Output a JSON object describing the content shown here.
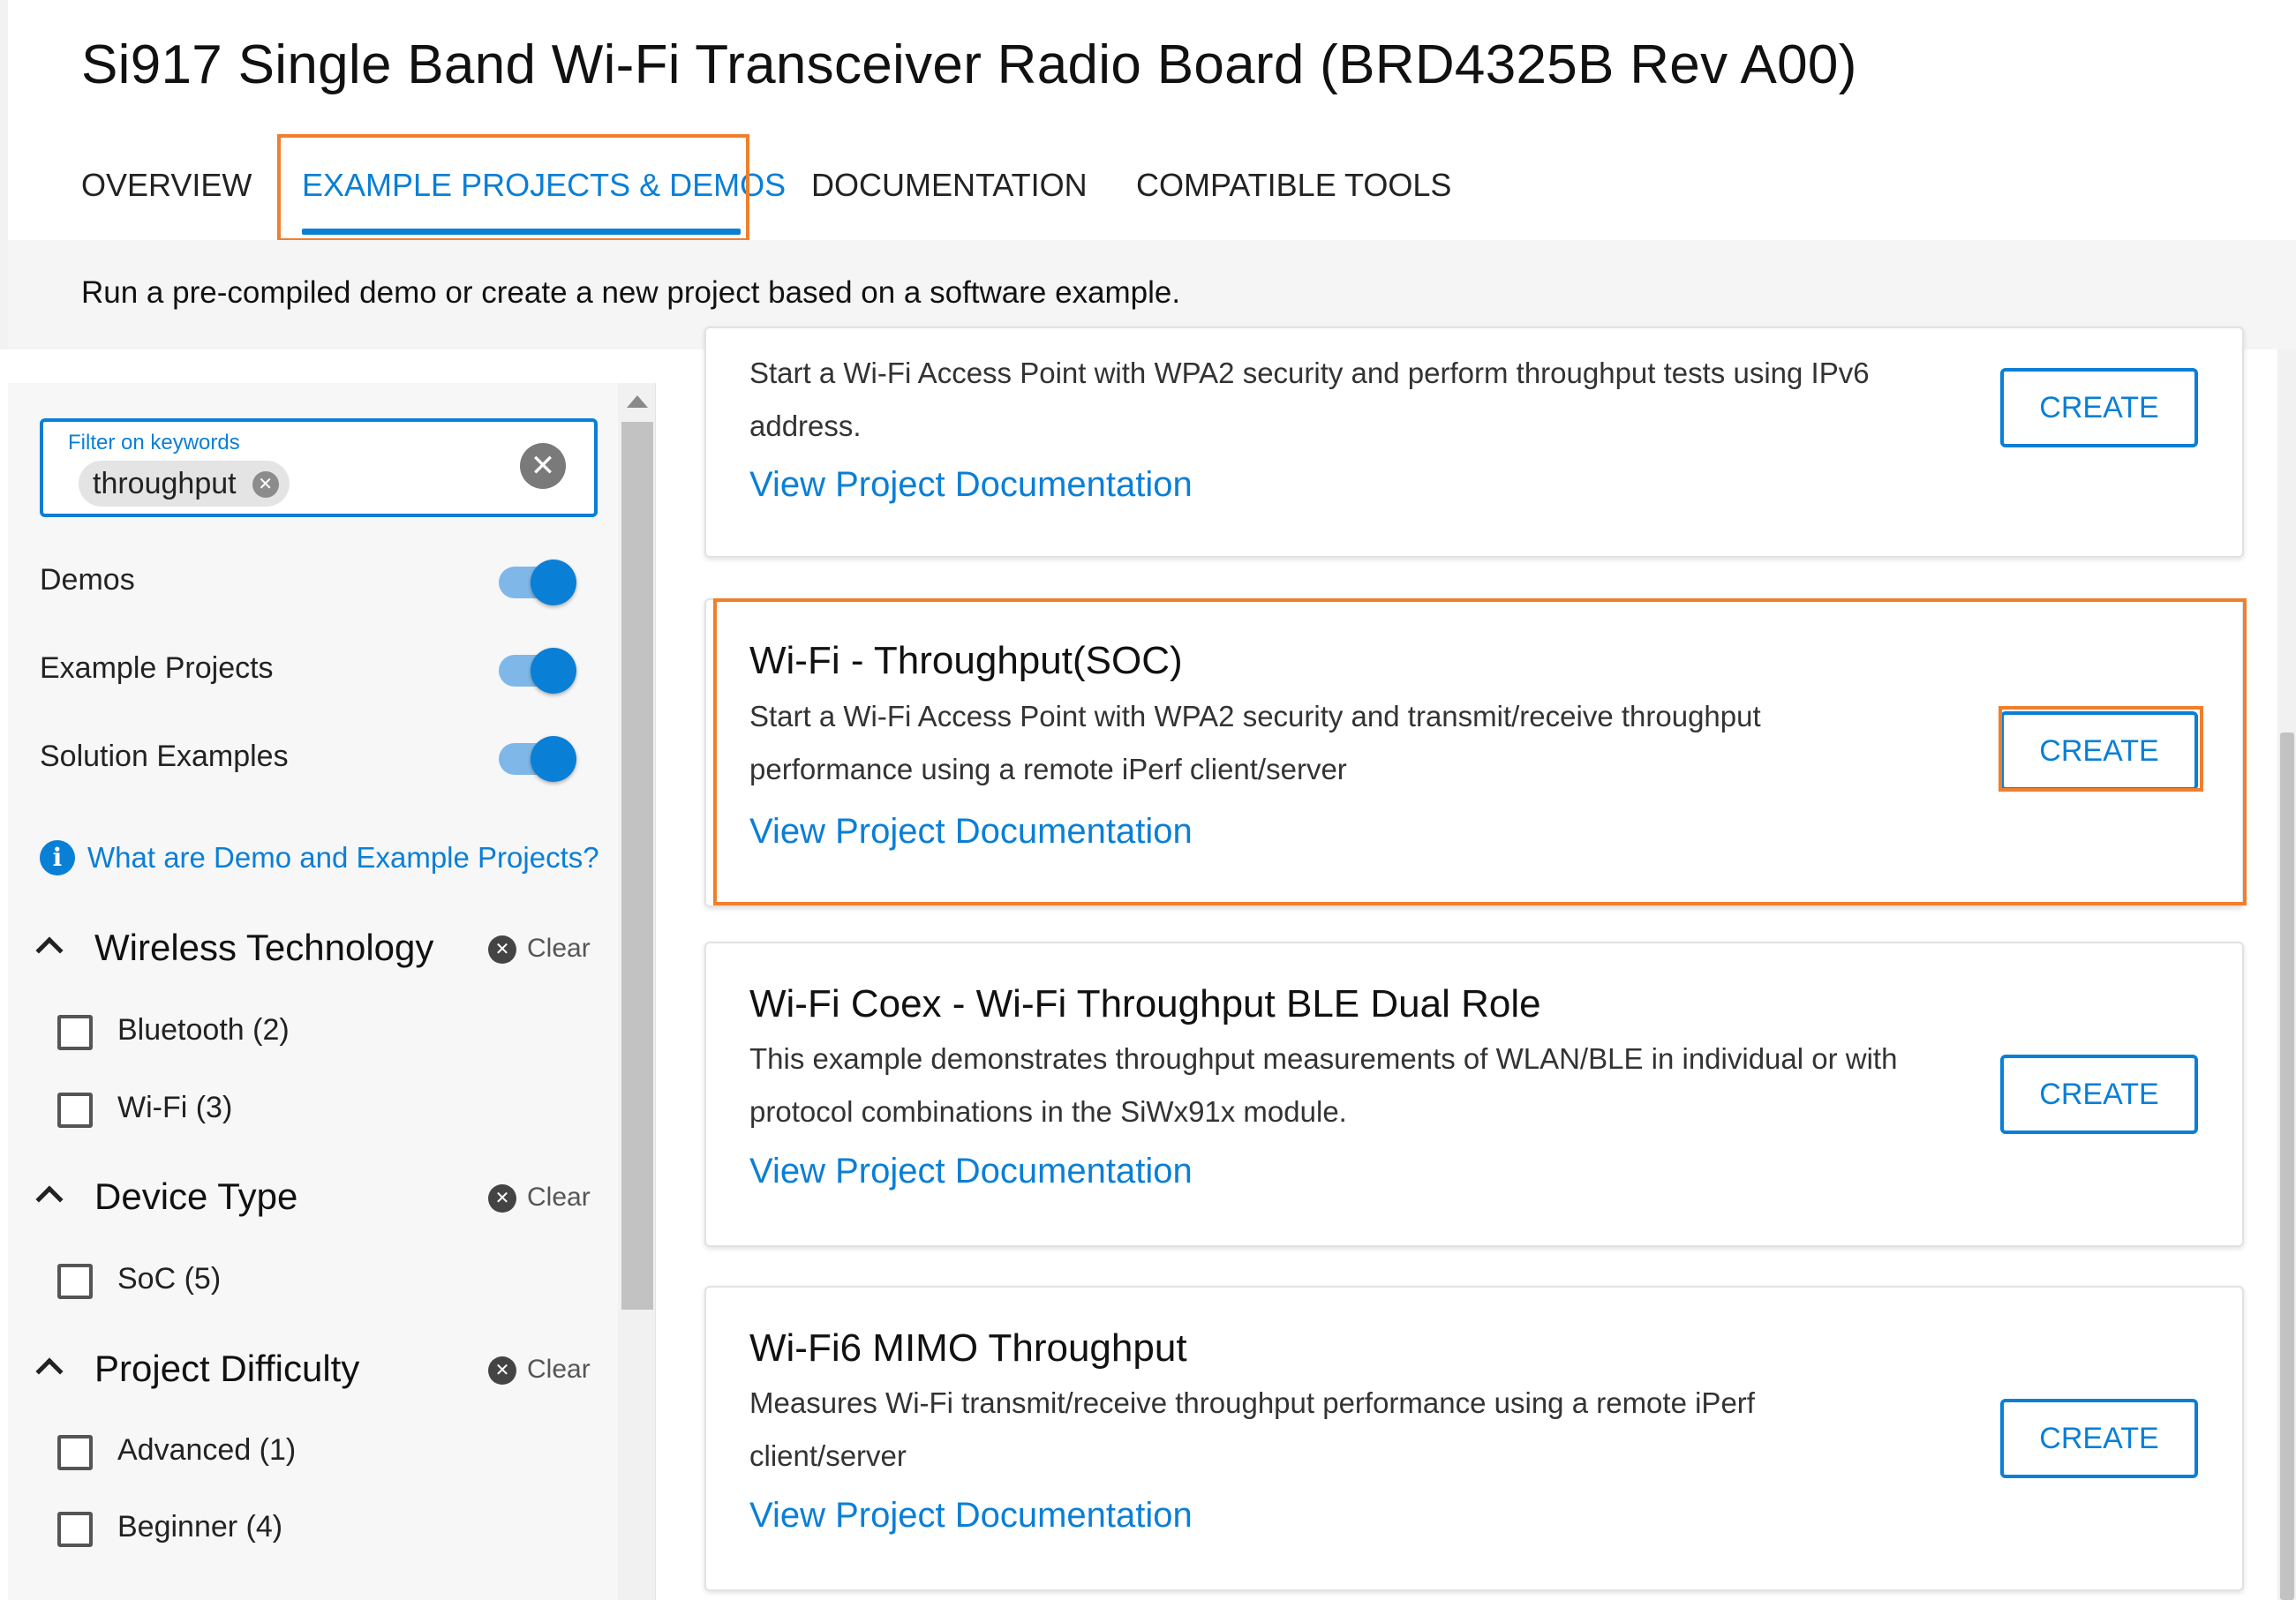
{
  "header": {
    "title": "Si917 Single Band Wi-Fi Transceiver Radio Board (BRD4325B Rev A00)",
    "tabs": [
      {
        "label": "OVERVIEW"
      },
      {
        "label": "EXAMPLE PROJECTS & DEMOS",
        "active": true
      },
      {
        "label": "DOCUMENTATION"
      },
      {
        "label": "COMPATIBLE TOOLS"
      }
    ]
  },
  "subheader": {
    "text": "Run a pre-compiled demo or create a new project based on a software example."
  },
  "sidebar": {
    "filter": {
      "label": "Filter on keywords",
      "chip": "throughput"
    },
    "toggles": [
      {
        "label": "Demos",
        "on": true
      },
      {
        "label": "Example Projects",
        "on": true
      },
      {
        "label": "Solution Examples",
        "on": true
      }
    ],
    "info_link": "What are Demo and Example Projects?",
    "clear_label": "Clear",
    "sections": [
      {
        "title": "Wireless Technology",
        "options": [
          {
            "label": "Bluetooth (2)"
          },
          {
            "label": "Wi-Fi (3)"
          }
        ]
      },
      {
        "title": "Device Type",
        "options": [
          {
            "label": "SoC (5)"
          }
        ]
      },
      {
        "title": "Project Difficulty",
        "options": [
          {
            "label": "Advanced (1)"
          },
          {
            "label": "Beginner (4)"
          }
        ]
      }
    ]
  },
  "projects": {
    "link_label": "View Project Documentation",
    "create_label": "CREATE",
    "items": [
      {
        "title": "",
        "description": "Start a Wi-Fi Access Point with WPA2 security and perform throughput tests using IPv6 address."
      },
      {
        "title": "Wi-Fi - Throughput(SOC)",
        "description": "Start a Wi-Fi Access Point with WPA2 security and transmit/receive throughput performance using a remote iPerf client/server",
        "highlighted": true
      },
      {
        "title": "Wi-Fi Coex - Wi-Fi Throughput BLE Dual Role",
        "description": "This example demonstrates throughput measurements of WLAN/BLE in individual or with protocol combinations in the SiWx91x module."
      },
      {
        "title": "Wi-Fi6 MIMO Throughput",
        "description": "Measures Wi-Fi transmit/receive throughput performance using a remote iPerf client/server"
      }
    ]
  },
  "colors": {
    "accent": "#0a7fd6",
    "highlight": "#f07f2d"
  },
  "icons": [
    "info-icon",
    "clear-icon",
    "chevron-up-icon",
    "close-icon"
  ]
}
